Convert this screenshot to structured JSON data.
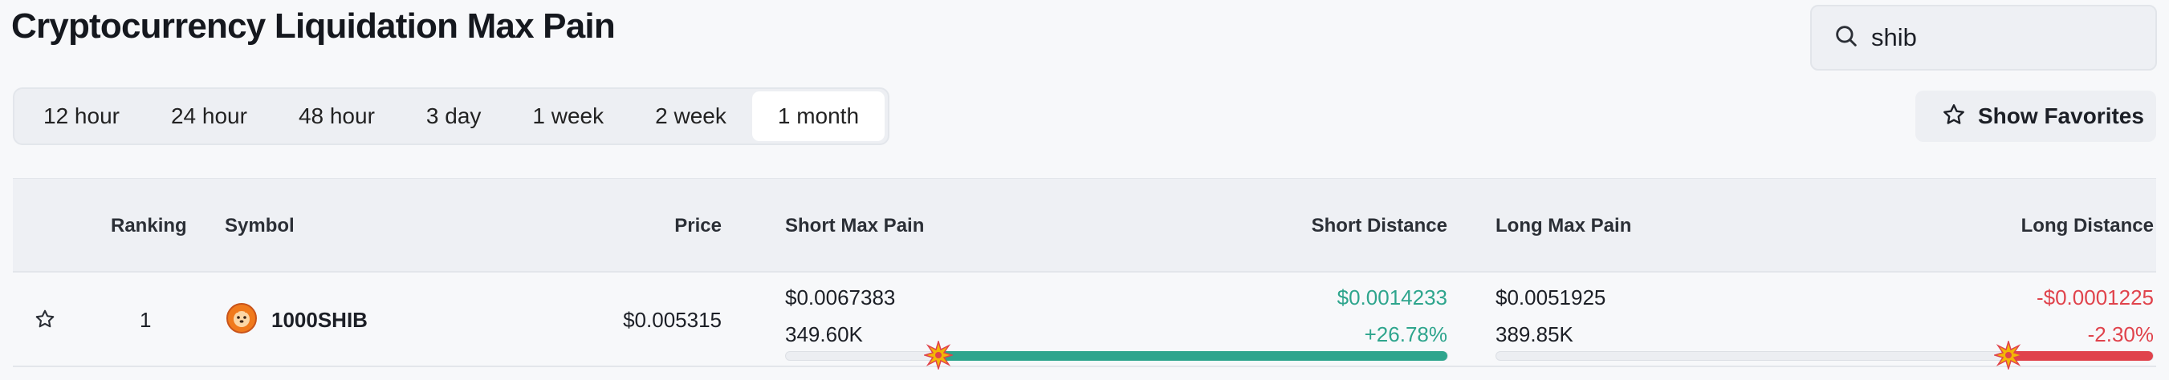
{
  "page": {
    "title": "Cryptocurrency Liquidation Max Pain"
  },
  "search": {
    "value": "shib"
  },
  "tabs": [
    {
      "label": "12 hour"
    },
    {
      "label": "24 hour"
    },
    {
      "label": "48 hour"
    },
    {
      "label": "3 day"
    },
    {
      "label": "1 week"
    },
    {
      "label": "2 week"
    },
    {
      "label": "1 month",
      "active": true
    }
  ],
  "favorites_button": {
    "label": "Show Favorites",
    "icon": "star-icon"
  },
  "table": {
    "headers": {
      "ranking": "Ranking",
      "symbol": "Symbol",
      "price": "Price",
      "short_max_pain": "Short Max Pain",
      "short_distance": "Short Distance",
      "long_max_pain": "Long Max Pain",
      "long_distance": "Long Distance"
    },
    "rows": [
      {
        "ranking": "1",
        "symbol": "1000SHIB",
        "symbol_icon": "shib-icon",
        "price": "$0.005315",
        "short_max_pain_price": "$0.0067383",
        "short_max_pain_amount": "349.60K",
        "short_distance_value": "$0.0014233",
        "short_distance_pct": "+26.78%",
        "short_bar_fill": 0.77,
        "long_max_pain_price": "$0.0051925",
        "long_max_pain_amount": "389.85K",
        "long_distance_value": "-$0.0001225",
        "long_distance_pct": "-2.30%",
        "long_bar_fill": 0.22
      }
    ]
  },
  "colors": {
    "positive": "#2ea58d",
    "negative": "#e0434c",
    "accent_burst": "#f2b705"
  }
}
